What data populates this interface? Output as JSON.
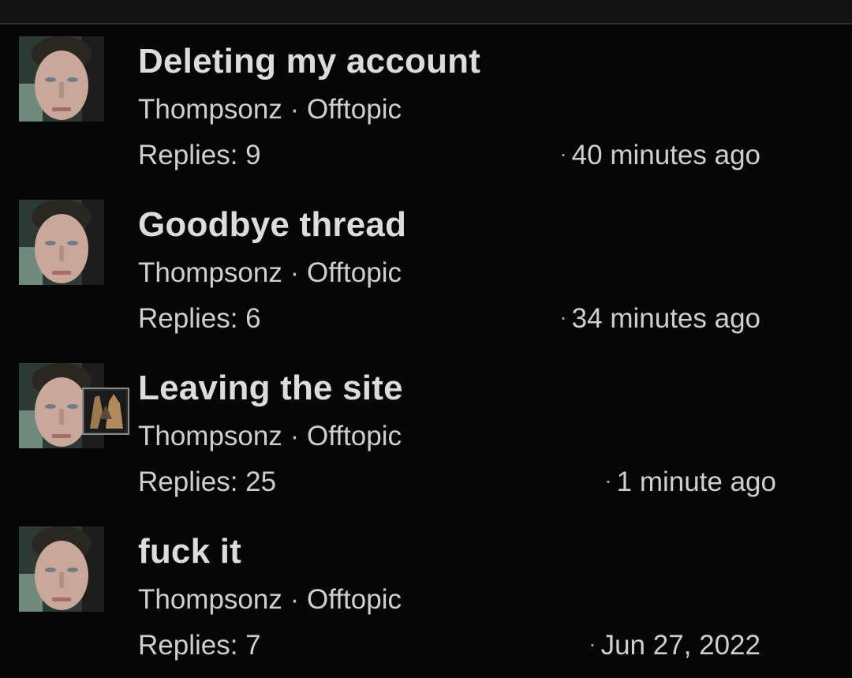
{
  "threads": [
    {
      "title": "Deleting my account",
      "author": "Thompsonz",
      "separator": "·",
      "forum": "Offtopic",
      "replies": "Replies: 9",
      "time": "40 minutes ago"
    },
    {
      "title": "Goodbye thread",
      "author": "Thompsonz",
      "separator": "·",
      "forum": "Offtopic",
      "replies": "Replies: 6",
      "time": "34 minutes ago"
    },
    {
      "title": "Leaving the site",
      "author": "Thompsonz",
      "separator": "·",
      "forum": "Offtopic",
      "replies": "Replies: 25",
      "time": "1 minute ago"
    },
    {
      "title": "fuck it",
      "author": "Thompsonz",
      "separator": "·",
      "forum": "Offtopic",
      "replies": "Replies: 7",
      "time": "Jun 27, 2022"
    }
  ],
  "time_dot": "·",
  "colors": {
    "background": "#060606",
    "top_bar": "#141414",
    "text": "#cfcfcf",
    "title": "#dcdcdc"
  }
}
